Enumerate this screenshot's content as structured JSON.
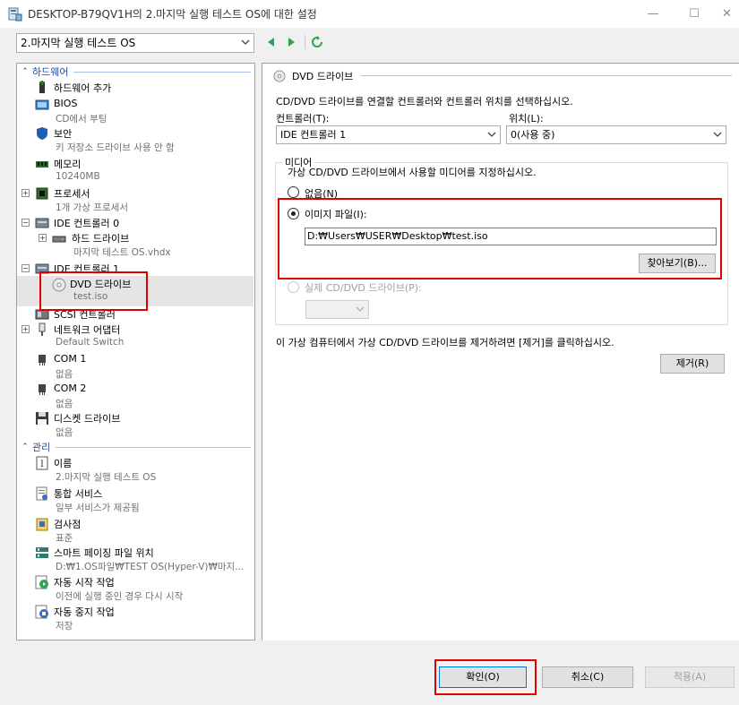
{
  "window": {
    "title": "DESKTOP-B79QV1H의 2.마지막 실행 테스트 OS에 대한 설정",
    "min_glyph": "—",
    "max_glyph": "☐",
    "close_glyph": "✕"
  },
  "vm_selector": {
    "value": "2.마지막 실행 테스트 OS"
  },
  "sections": {
    "hardware": "하드웨어",
    "management": "관리"
  },
  "hardware_items": [
    {
      "label": "하드웨어 추가",
      "sub": "",
      "icon": "add-hardware-icon"
    },
    {
      "label": "BIOS",
      "sub": "CD에서 부팅",
      "icon": "bios-icon"
    },
    {
      "label": "보안",
      "sub": "키 저장소 드라이브 사용 안 함",
      "icon": "shield-icon"
    },
    {
      "label": "메모리",
      "sub": "10240MB",
      "icon": "memory-icon"
    },
    {
      "label": "프로세서",
      "sub": "1개 가상 프로세서",
      "icon": "processor-icon"
    },
    {
      "label": "IDE 컨트롤러 0",
      "sub": "",
      "icon": "ide-controller-icon"
    },
    {
      "label": "하드 드라이브",
      "sub": "마지막 테스트 OS.vhdx",
      "icon": "hard-drive-icon"
    },
    {
      "label": "IDE 컨트롤러 1",
      "sub": "",
      "icon": "ide-controller-icon"
    },
    {
      "label": "DVD 드라이브",
      "sub": "test.iso",
      "icon": "dvd-icon"
    },
    {
      "label": "SCSI 컨트롤러",
      "sub": "",
      "icon": "scsi-icon"
    },
    {
      "label": "네트워크 어댑터",
      "sub": "Default Switch",
      "icon": "network-adapter-icon"
    },
    {
      "label": "COM 1",
      "sub": "없음",
      "icon": "com-port-icon"
    },
    {
      "label": "COM 2",
      "sub": "없음",
      "icon": "com-port-icon"
    },
    {
      "label": "디스켓 드라이브",
      "sub": "없음",
      "icon": "floppy-icon"
    }
  ],
  "management_items": [
    {
      "label": "이름",
      "sub": "2.마지막 실행 테스트 OS",
      "icon": "name-icon"
    },
    {
      "label": "통합 서비스",
      "sub": "일부 서비스가 제공됨",
      "icon": "integration-services-icon"
    },
    {
      "label": "검사점",
      "sub": "표준",
      "icon": "checkpoint-icon"
    },
    {
      "label": "스마트 페이징 파일 위치",
      "sub": "D:₩1.OS파일₩TEST OS(Hyper-V)₩마지...",
      "icon": "smart-paging-icon"
    },
    {
      "label": "자동 시작 작업",
      "sub": "이전에 실행 중인 경우 다시 시작",
      "icon": "auto-start-icon"
    },
    {
      "label": "자동 중지 작업",
      "sub": "저장",
      "icon": "auto-stop-icon"
    }
  ],
  "dvd_panel": {
    "title": "DVD 드라이브",
    "description": "CD/DVD 드라이브를 연결할 컨트롤러와 컨트롤러 위치를 선택하십시오.",
    "controller_label": "컨트롤러(T):",
    "controller_value": "IDE 컨트롤러 1",
    "location_label": "위치(L):",
    "location_value": "0(사용 중)",
    "media_legend": "미디어",
    "media_description": "가상 CD/DVD 드라이브에서 사용할 미디어를 지정하십시오.",
    "radio_none": "없음(N)",
    "radio_image": "이미지 파일(I):",
    "image_path": "D:₩Users₩USER₩Desktop₩test.iso",
    "browse_button": "찾아보기(B)...",
    "radio_physical": "실제 CD/DVD 드라이브(P):",
    "remove_hint": "이 가상 컴퓨터에서 가상 CD/DVD 드라이브를 제거하려면 [제거]를 클릭하십시오.",
    "remove_button": "제거(R)"
  },
  "footer": {
    "ok": "확인(O)",
    "cancel": "취소(C)",
    "apply": "적용(A)"
  },
  "colors": {
    "section_header": "#1a4aa0",
    "highlight_box": "#e00000",
    "nav_green": "#2ea44f"
  }
}
